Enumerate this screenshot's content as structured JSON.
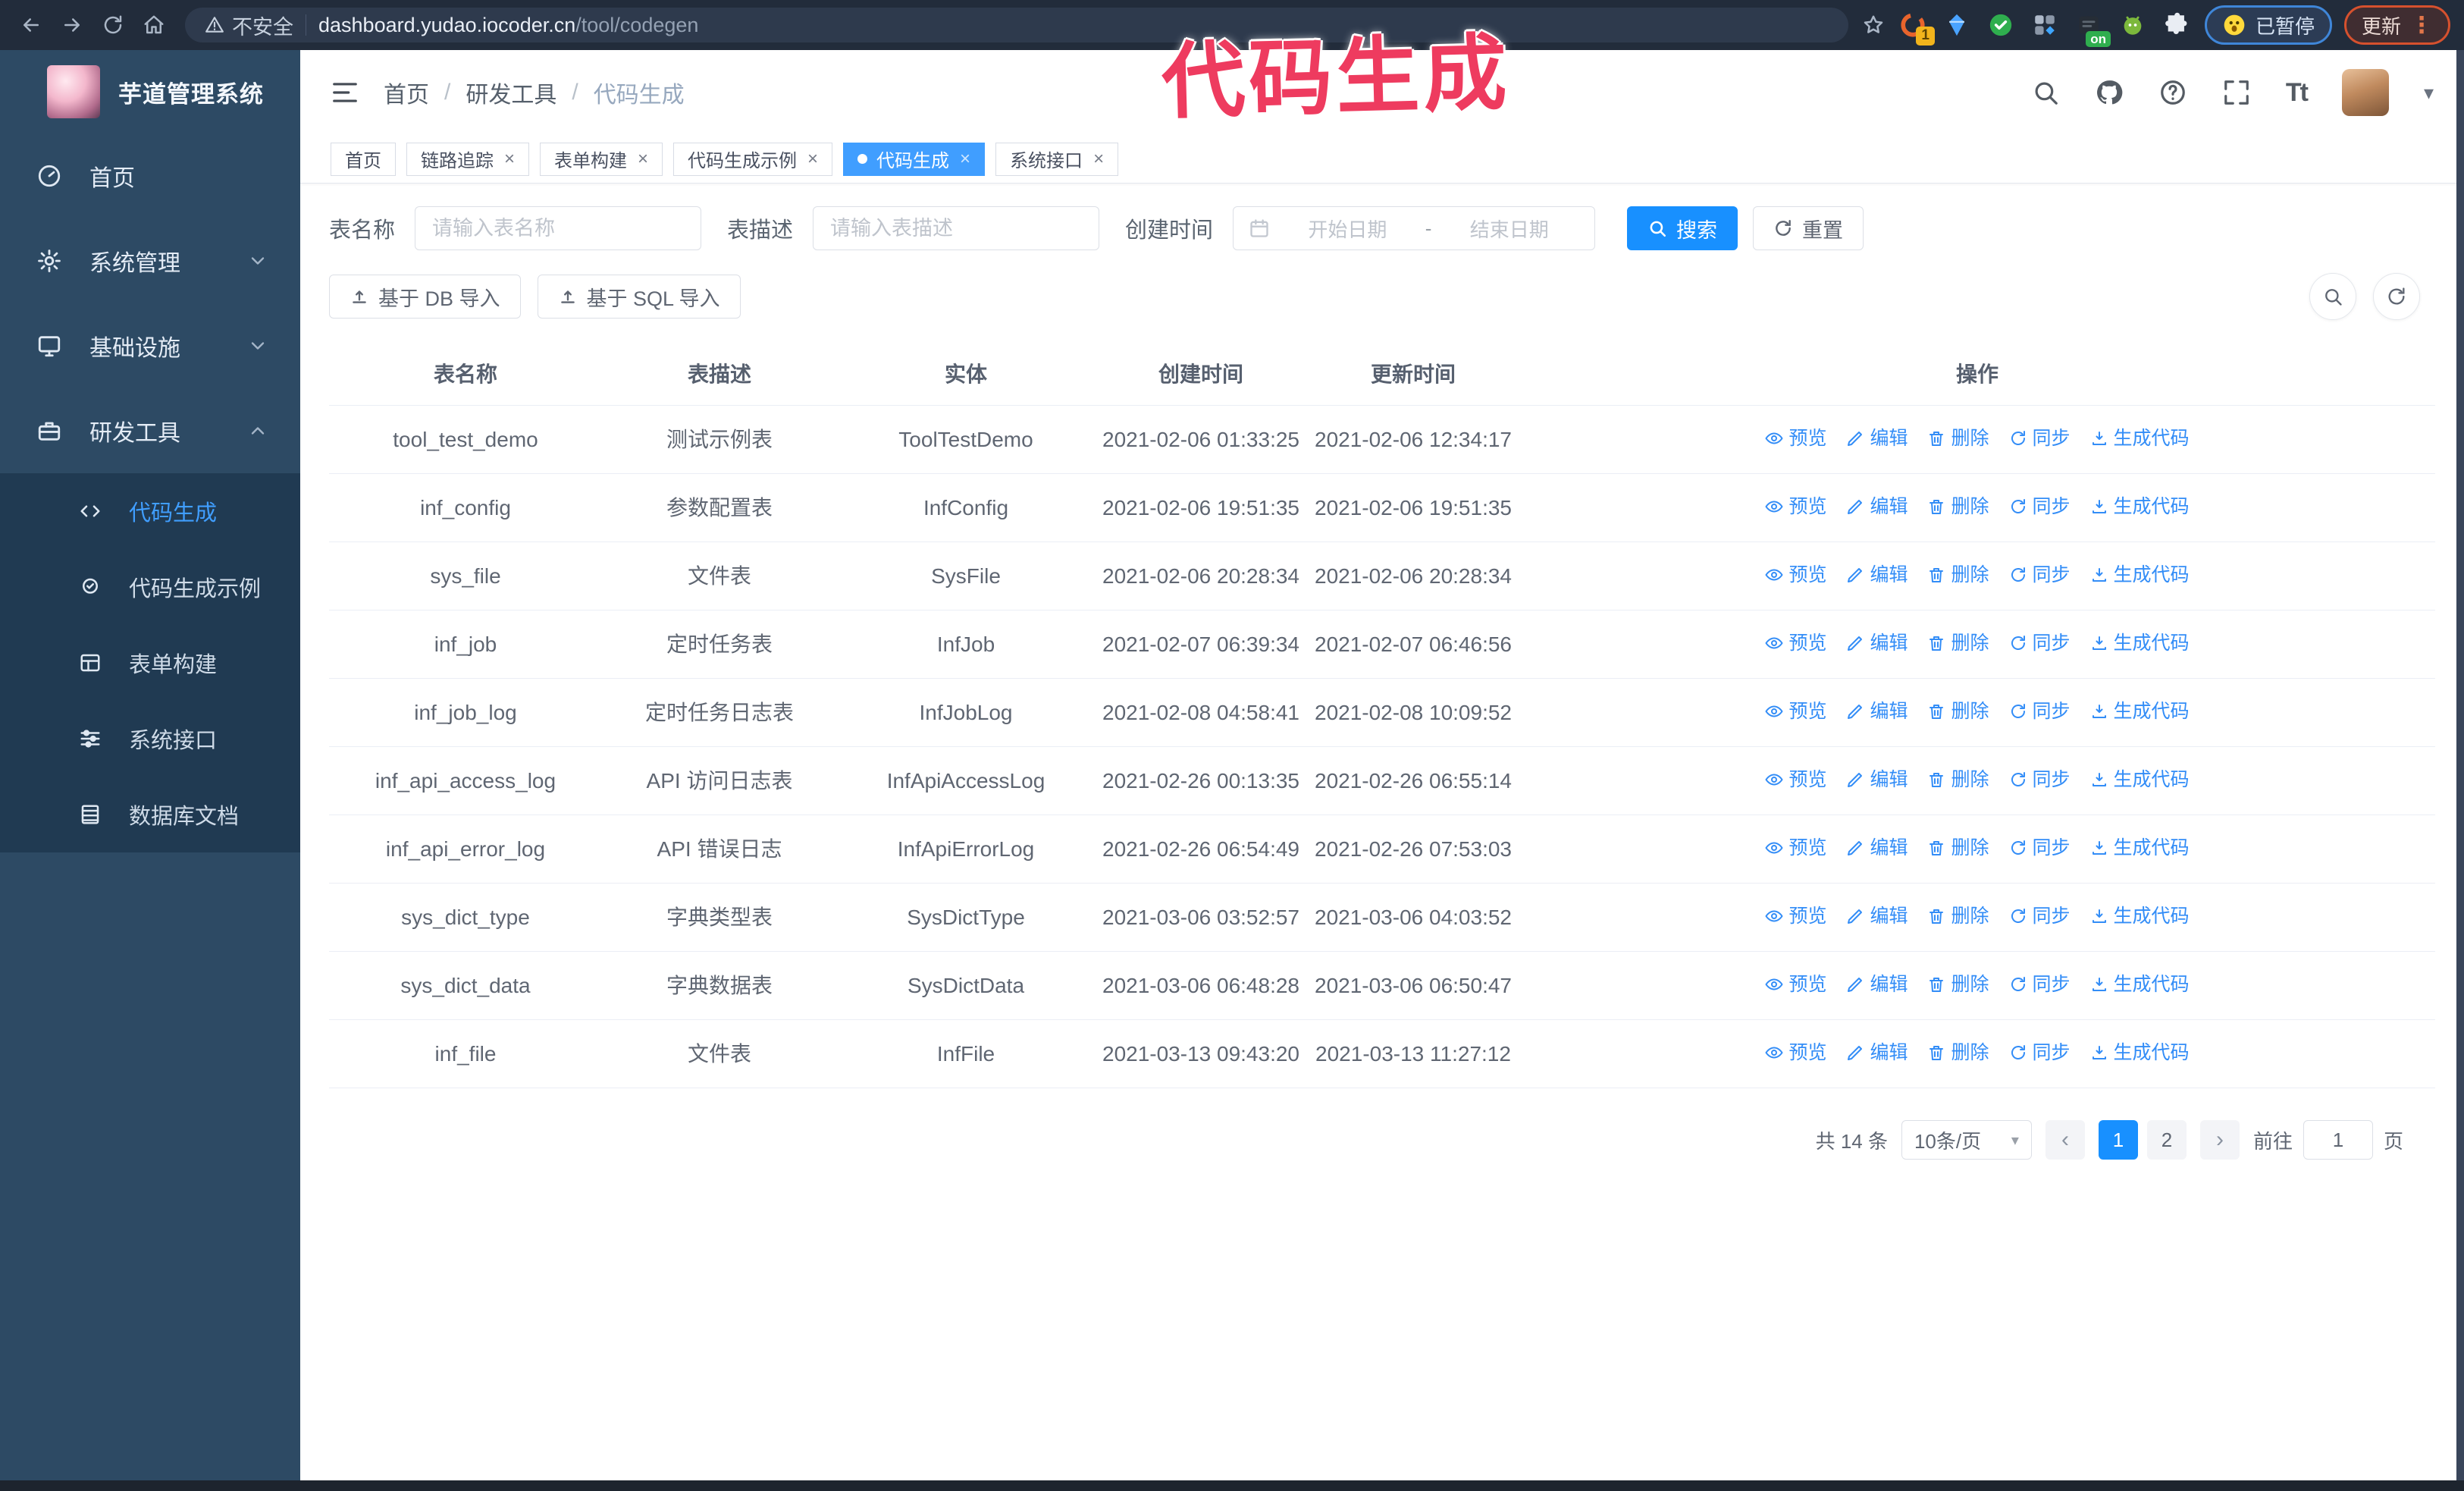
{
  "colors": {
    "accent": "#409eff",
    "primary": "#1890ff",
    "annotation": "#ee3b5f",
    "sidebar_bg": "#2d4a64",
    "submenu_bg": "#203a52"
  },
  "annotation": {
    "title": "代码生成"
  },
  "browser": {
    "security_label": "不安全",
    "url_host": "dashboard.yudao.iocoder.cn",
    "url_path": "/tool/codegen",
    "ext_badge": "1",
    "ext_on_label": "on",
    "paused_label": "已暂停",
    "update_label": "更新"
  },
  "sidebar": {
    "app_title": "芋道管理系统",
    "items": [
      {
        "label": "首页",
        "chevron": null
      },
      {
        "label": "系统管理",
        "chevron": "down"
      },
      {
        "label": "基础设施",
        "chevron": "down"
      },
      {
        "label": "研发工具",
        "chevron": "up"
      }
    ],
    "subitems": [
      {
        "label": "代码生成",
        "active": true
      },
      {
        "label": "代码生成示例",
        "active": false
      },
      {
        "label": "表单构建",
        "active": false
      },
      {
        "label": "系统接口",
        "active": false
      },
      {
        "label": "数据库文档",
        "active": false
      }
    ]
  },
  "header": {
    "breadcrumb": [
      "首页",
      "研发工具",
      "代码生成"
    ]
  },
  "tabs": [
    {
      "label": "首页",
      "closable": false,
      "active": false
    },
    {
      "label": "链路追踪",
      "closable": true,
      "active": false
    },
    {
      "label": "表单构建",
      "closable": true,
      "active": false
    },
    {
      "label": "代码生成示例",
      "closable": true,
      "active": false
    },
    {
      "label": "代码生成",
      "closable": true,
      "active": true
    },
    {
      "label": "系统接口",
      "closable": true,
      "active": false
    }
  ],
  "search": {
    "table_name_label": "表名称",
    "table_name_placeholder": "请输入表名称",
    "table_desc_label": "表描述",
    "table_desc_placeholder": "请输入表描述",
    "create_time_label": "创建时间",
    "start_placeholder": "开始日期",
    "range_separator": "-",
    "end_placeholder": "结束日期",
    "search_label": "搜索",
    "reset_label": "重置"
  },
  "toolbar": {
    "import_db_label": "基于 DB 导入",
    "import_sql_label": "基于 SQL 导入"
  },
  "table": {
    "columns": [
      "表名称",
      "表描述",
      "实体",
      "创建时间",
      "更新时间",
      "操作"
    ],
    "actions": [
      "预览",
      "编辑",
      "删除",
      "同步",
      "生成代码"
    ],
    "rows": [
      {
        "name": "tool_test_demo",
        "desc": "测试示例表",
        "entity": "ToolTestDemo",
        "created": "2021-02-06 01:33:25",
        "updated": "2021-02-06 12:34:17"
      },
      {
        "name": "inf_config",
        "desc": "参数配置表",
        "entity": "InfConfig",
        "created": "2021-02-06 19:51:35",
        "updated": "2021-02-06 19:51:35"
      },
      {
        "name": "sys_file",
        "desc": "文件表",
        "entity": "SysFile",
        "created": "2021-02-06 20:28:34",
        "updated": "2021-02-06 20:28:34"
      },
      {
        "name": "inf_job",
        "desc": "定时任务表",
        "entity": "InfJob",
        "created": "2021-02-07 06:39:34",
        "updated": "2021-02-07 06:46:56"
      },
      {
        "name": "inf_job_log",
        "desc": "定时任务日志表",
        "entity": "InfJobLog",
        "created": "2021-02-08 04:58:41",
        "updated": "2021-02-08 10:09:52"
      },
      {
        "name": "inf_api_access_log",
        "desc": "API 访问日志表",
        "entity": "InfApiAccessLog",
        "created": "2021-02-26 00:13:35",
        "updated": "2021-02-26 06:55:14"
      },
      {
        "name": "inf_api_error_log",
        "desc": "API 错误日志",
        "entity": "InfApiErrorLog",
        "created": "2021-02-26 06:54:49",
        "updated": "2021-02-26 07:53:03"
      },
      {
        "name": "sys_dict_type",
        "desc": "字典类型表",
        "entity": "SysDictType",
        "created": "2021-03-06 03:52:57",
        "updated": "2021-03-06 04:03:52"
      },
      {
        "name": "sys_dict_data",
        "desc": "字典数据表",
        "entity": "SysDictData",
        "created": "2021-03-06 06:48:28",
        "updated": "2021-03-06 06:50:47"
      },
      {
        "name": "inf_file",
        "desc": "文件表",
        "entity": "InfFile",
        "created": "2021-03-13 09:43:20",
        "updated": "2021-03-13 11:27:12"
      }
    ]
  },
  "pagination": {
    "total_label": "共 14 条",
    "page_size_label": "10条/页",
    "pages": [
      "1",
      "2"
    ],
    "active_page": "1",
    "prev_label": "‹",
    "next_label": "›",
    "goto_label": "前往",
    "goto_value": "1",
    "page_suffix": "页"
  }
}
